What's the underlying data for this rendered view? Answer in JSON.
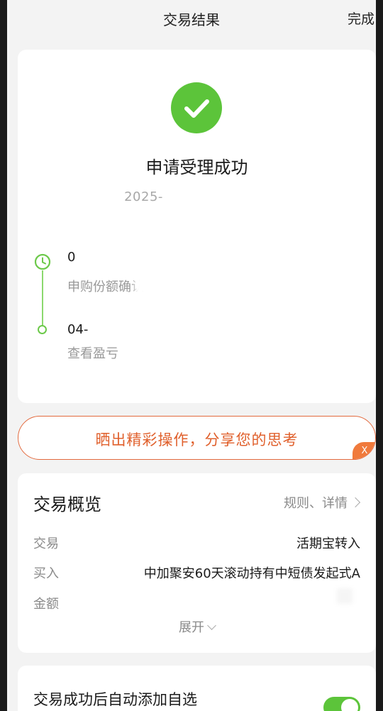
{
  "header": {
    "title": "交易结果",
    "done_label": "完成"
  },
  "result": {
    "title": "申请受理成功",
    "time_visible": "2025-"
  },
  "timeline": {
    "steps": [
      {
        "title": "0",
        "desc": "申购份额确认"
      },
      {
        "title": "04-",
        "desc": "查看盈亏"
      }
    ]
  },
  "share": {
    "text": "晒出精彩操作，分享您的思考",
    "close_label": "X"
  },
  "overview": {
    "title": "交易概览",
    "link_label": "规则、详情",
    "rows": [
      {
        "key": "交易",
        "value": "活期宝转入"
      },
      {
        "key": "买入",
        "value": "中加聚安60天滚动持有中短债发起式A"
      },
      {
        "key": "金额",
        "value": ""
      }
    ],
    "expand_label": "展开"
  },
  "auto_watch": {
    "text": "交易成功后自动添加自选",
    "enabled": true
  },
  "colors": {
    "success_green": "#5cc43a",
    "accent_orange": "#e0602c",
    "page_bg": "#f3f3f3"
  }
}
